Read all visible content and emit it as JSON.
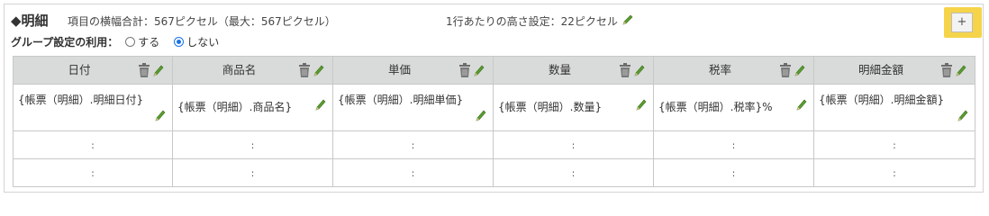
{
  "section": {
    "title": "◆明細",
    "width_info": "項目の横幅合計：567ピクセル（最大：567ピクセル）",
    "row_height_info": "1行あたりの高さ設定：22ピクセル",
    "add_label": "+"
  },
  "group": {
    "label": "グループ設定の利用：",
    "options": [
      {
        "label": "する",
        "checked": false
      },
      {
        "label": "しない",
        "checked": true
      }
    ]
  },
  "columns": [
    {
      "header": "日付",
      "value": "{帳票（明細）.明細日付}"
    },
    {
      "header": "商品名",
      "value": "{帳票（明細）.商品名}"
    },
    {
      "header": "単価",
      "value": "{帳票（明細）.明細単価}"
    },
    {
      "header": "数量",
      "value": "{帳票（明細）.数量}"
    },
    {
      "header": "税率",
      "value": "{帳票（明細）.税率}%"
    },
    {
      "header": "明細金額",
      "value": "{帳票（明細）.明細金額}"
    }
  ],
  "empty_marker": ":",
  "colors": {
    "header_bg": "#d8dbd9",
    "accent": "#f5d44a",
    "pencil": "#5a9e2f"
  }
}
